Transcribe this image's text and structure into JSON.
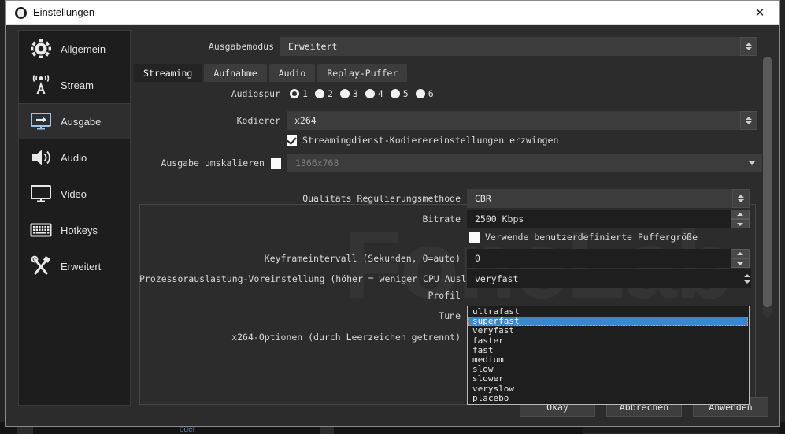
{
  "window": {
    "title": "Einstellungen",
    "logo_icon": "obs-logo-icon",
    "close_icon": "close-icon"
  },
  "sidebar": {
    "items": [
      {
        "label": "Allgemein",
        "icon": "gear-icon",
        "selected": false
      },
      {
        "label": "Stream",
        "icon": "broadcast-icon",
        "selected": false
      },
      {
        "label": "Ausgabe",
        "icon": "monitor-output-icon",
        "selected": true
      },
      {
        "label": "Audio",
        "icon": "speaker-icon",
        "selected": false
      },
      {
        "label": "Video",
        "icon": "display-icon",
        "selected": false
      },
      {
        "label": "Hotkeys",
        "icon": "keyboard-icon",
        "selected": false
      },
      {
        "label": "Erweitert",
        "icon": "tools-icon",
        "selected": false
      }
    ]
  },
  "output_mode": {
    "label": "Ausgabemodus",
    "value": "Erweitert"
  },
  "tabs": [
    {
      "label": "Streaming",
      "active": true
    },
    {
      "label": "Aufnahme",
      "active": false
    },
    {
      "label": "Audio",
      "active": false
    },
    {
      "label": "Replay-Puffer",
      "active": false
    }
  ],
  "audio_track": {
    "label": "Audiospur",
    "options": [
      "1",
      "2",
      "3",
      "4",
      "5",
      "6"
    ],
    "selected": "1"
  },
  "encoder": {
    "label": "Kodierer",
    "value": "x264"
  },
  "enforce": {
    "label": "Streamingdienst-Kodierereinstellungen erzwingen",
    "checked": true
  },
  "rescale": {
    "label": "Ausgabe umskalieren",
    "checked": false,
    "value": "1366x768"
  },
  "encoder_settings": {
    "rate_control": {
      "label": "Qualitäts Regulierungsmethode",
      "value": "CBR"
    },
    "bitrate": {
      "label": "Bitrate",
      "value": "2500 Kbps"
    },
    "custom_buffer": {
      "label": "Verwende benutzerdefinierte Puffergröße",
      "checked": false
    },
    "keyframe": {
      "label": "Keyframeintervall (Sekunden, 0=auto)",
      "value": "0"
    },
    "cpu_preset": {
      "label": "Prozessorauslastung-Voreinstellung (höher = weniger CPU Auslastung)",
      "value": "veryfast"
    },
    "profile": {
      "label": "Profil"
    },
    "tune": {
      "label": "Tune"
    },
    "x264_options": {
      "label": "x264-Optionen (durch Leerzeichen getrennt)"
    }
  },
  "preset_dropdown": {
    "open": true,
    "options": [
      {
        "label": "ultrafast",
        "selected": false
      },
      {
        "label": "superfast",
        "selected": true
      },
      {
        "label": "veryfast",
        "selected": false
      },
      {
        "label": "faster",
        "selected": false
      },
      {
        "label": "fast",
        "selected": false
      },
      {
        "label": "medium",
        "selected": false
      },
      {
        "label": "slow",
        "selected": false
      },
      {
        "label": "slower",
        "selected": false
      },
      {
        "label": "veryslow",
        "selected": false
      },
      {
        "label": "placebo",
        "selected": false
      }
    ],
    "highlight_color": "#3a86cf"
  },
  "footer": {
    "ok": "Okay",
    "cancel": "Abbrechen",
    "apply": "Anwenden"
  },
  "watermark": {
    "text": "FoneLab"
  },
  "background": {
    "label": "oder"
  }
}
